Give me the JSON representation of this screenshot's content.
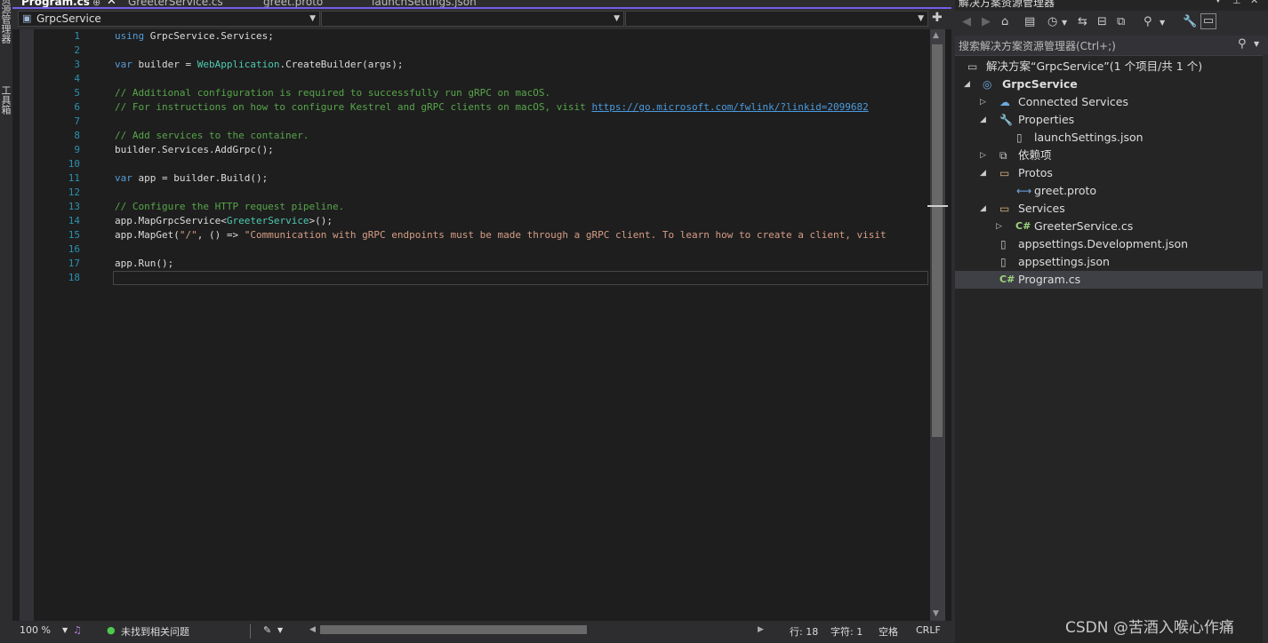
{
  "left_strip": {
    "labels": [
      "资源管理器",
      "工具箱"
    ]
  },
  "tabs": [
    {
      "label": "Program.cs",
      "active": true
    },
    {
      "label": "GreeterService.cs",
      "active": false
    },
    {
      "label": "greet.proto",
      "active": false
    },
    {
      "label": "launchSettings.json",
      "active": false
    }
  ],
  "tab_icons": {
    "pin": "pin-icon",
    "close": "close-icon"
  },
  "navbar": {
    "project": "GrpcService",
    "member1": "",
    "member2": ""
  },
  "code": {
    "line_numbers": [
      "1",
      "2",
      "3",
      "4",
      "5",
      "6",
      "7",
      "8",
      "9",
      "10",
      "11",
      "12",
      "13",
      "14",
      "15",
      "16",
      "17",
      "18"
    ],
    "l1_kw": "using",
    "l1_rest": " GrpcService.Services;",
    "l3_kw": "var",
    "l3_a": " builder = ",
    "l3_ty": "WebApplication",
    "l3_b": ".CreateBuilder(args);",
    "l5": "// Additional configuration is required to successfully run gRPC on macOS.",
    "l6_a": "// For instructions on how to configure Kestrel and gRPC clients on macOS, visit ",
    "l6_link": "https://go.microsoft.com/fwlink/?linkid=2099682",
    "l8": "// Add services to the container.",
    "l9": "builder.Services.AddGrpc();",
    "l11_kw": "var",
    "l11_rest": " app = builder.Build();",
    "l13": "// Configure the HTTP request pipeline.",
    "l14_a": "app.MapGrpcService<",
    "l14_ty": "GreeterService",
    "l14_b": ">();",
    "l15_a": "app.MapGet(",
    "l15_s1": "\"/\"",
    "l15_b": ", () => ",
    "l15_s2": "\"Communication with gRPC endpoints must be made through a gRPC client. To learn how to create a client, visit",
    "l17": "app.Run();"
  },
  "status": {
    "zoom": "100 %",
    "issues": "未找到相关问题",
    "line": "行: 18",
    "char": "字符: 1",
    "space": "空格",
    "eol": "CRLF"
  },
  "solution_explorer": {
    "title": "解决方案资源管理器",
    "search_placeholder": "搜索解决方案资源管理器(Ctrl+;)",
    "items": [
      {
        "label": "解决方案“GrpcService”(1 个项目/共 1 个)",
        "icon": "solution-icon"
      },
      {
        "label": "GrpcService",
        "icon": "project-icon"
      },
      {
        "label": "Connected Services",
        "icon": "connected-services-icon"
      },
      {
        "label": "Properties",
        "icon": "properties-icon"
      },
      {
        "label": "launchSettings.json",
        "icon": "json-file-icon"
      },
      {
        "label": "依赖项",
        "icon": "dependencies-icon"
      },
      {
        "label": "Protos",
        "icon": "folder-icon"
      },
      {
        "label": "greet.proto",
        "icon": "proto-file-icon"
      },
      {
        "label": "Services",
        "icon": "folder-icon"
      },
      {
        "label": "GreeterService.cs",
        "icon": "csharp-file-icon"
      },
      {
        "label": "appsettings.Development.json",
        "icon": "json-file-icon"
      },
      {
        "label": "appsettings.json",
        "icon": "json-file-icon"
      },
      {
        "label": "Program.cs",
        "icon": "csharp-file-icon"
      }
    ]
  },
  "watermark": "CSDN @苦酒入喉心作痛",
  "colors": {
    "accent": "#7160e8",
    "keyword": "#569cd6",
    "type": "#4ec9b0",
    "comment": "#57a64a",
    "string": "#d69d85",
    "line_number": "#2b91af"
  }
}
